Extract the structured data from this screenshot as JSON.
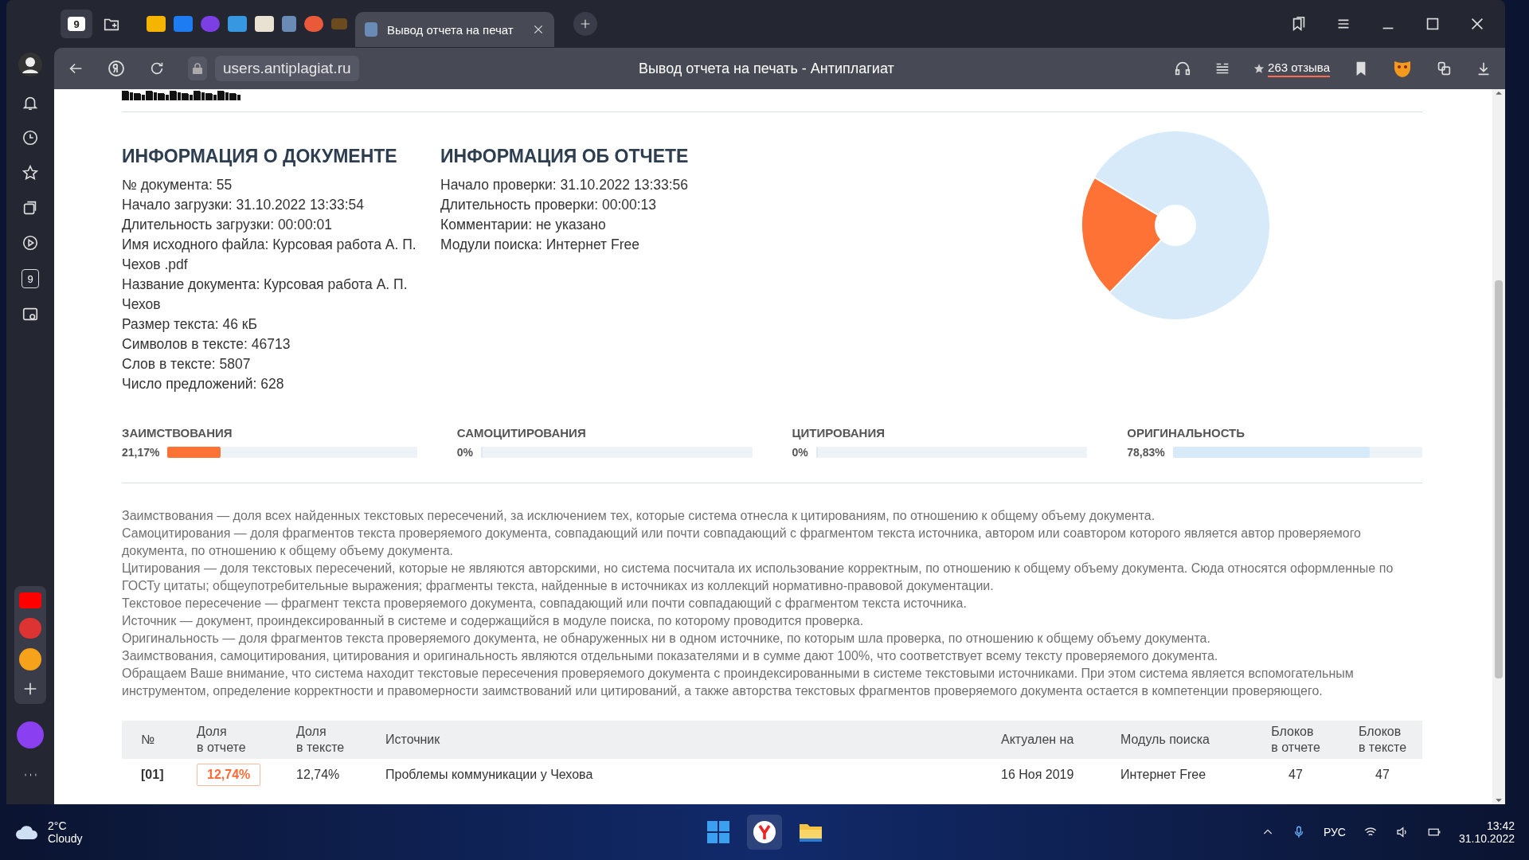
{
  "browser": {
    "home_badge": "9",
    "active_tab": {
      "title": "Вывод отчета на печат",
      "selected": true
    },
    "url": "users.antiplagiat.ru",
    "page_title": "Вывод отчета на печать - Антиплагиат",
    "reviews": "263 отзыва",
    "sidebar_badge": "9"
  },
  "document_info": {
    "title": "ИНФОРМАЦИЯ О ДОКУМЕНТЕ",
    "lines": [
      "№ документа: 55",
      "Начало загрузки: 31.10.2022 13:33:54",
      "Длительность загрузки: 00:00:01",
      "Имя исходного файла: Курсовая работа А. П. Чехов .pdf",
      "Название документа: Курсовая работа А. П. Чехов",
      "Размер текста: 46 кБ",
      "Символов в тексте: 46713",
      "Слов в тексте: 5807",
      "Число предложений: 628"
    ]
  },
  "report_info": {
    "title": "ИНФОРМАЦИЯ ОБ ОТЧЕТЕ",
    "lines": [
      "Начало проверки: 31.10.2022 13:33:56",
      "Длительность проверки: 00:00:13",
      "Комментарии: не указано",
      "Модули поиска: Интернет Free"
    ]
  },
  "stats": [
    {
      "label": "ЗАИМСТВОВАНИЯ",
      "value": "21,17%",
      "level": 0.2117,
      "color": "#ff7236"
    },
    {
      "label": "САМОЦИТИРОВАНИЯ",
      "value": "0%",
      "level": 0
    },
    {
      "label": "ЦИТИРОВАНИЯ",
      "value": "0%",
      "level": 0
    },
    {
      "label": "ОРИГИНАЛЬНОСТЬ",
      "value": "78,83%",
      "level": 0.7883,
      "color": "#d6eafa"
    }
  ],
  "notes": [
    "Заимствования — доля всех найденных текстовых пересечений, за исключением тех, которые система отнесла к цитированиям, по отношению к общему объему документа.",
    "Самоцитирования — доля фрагментов текста проверяемого документа, совпадающий или почти совпадающий с фрагментом текста источника, автором или соавтором которого является автор проверяемого документа, по отношению к общему объему документа.",
    "Цитирования — доля текстовых пересечений, которые не являются авторскими, но система посчитала их использование корректным, по отношению к общему объему документа. Сюда относятся оформленные по ГОСТу цитаты; общеупотребительные выражения; фрагменты текста, найденные в источниках из коллекций нормативно-правовой документации.",
    "Текстовое пересечение — фрагмент текста проверяемого документа, совпадающий или почти совпадающий с фрагментом текста источника.",
    "Источник — документ, проиндексированный в системе и содержащийся в модуле поиска, по которому проводится проверка.",
    "Оригинальность — доля фрагментов текста проверяемого документа, не обнаруженных ни в одном источнике, по которым шла проверка, по отношению к общему объему документа.",
    "Заимствования, самоцитирования, цитирования и оригинальность являются отдельными показателями и в сумме дают 100%, что соответствует всему тексту проверяемого документа.",
    "Обращаем Ваше внимание, что система находит текстовые пересечения проверяемого документа с проиндексированными в системе текстовыми источниками. При этом система является вспомогательным инструментом, определение корректности и правомерности заимствований или цитирований, а также авторства текстовых фрагментов проверяемого документа остается в компетенции проверяющего."
  ],
  "table": {
    "columns": [
      "№",
      "Доля в отчете",
      "Доля в тексте",
      "Источник",
      "Актуален на",
      "Модуль поиска",
      "Блоков в отчете",
      "Блоков в тексте"
    ],
    "rows": [
      {
        "cells": [
          "[01]",
          "12,74%",
          "12,74%",
          "Проблемы коммуникации у Чехова",
          "16 Ноя 2019",
          "Интернет Free",
          "47",
          "47"
        ]
      }
    ]
  },
  "taskbar": {
    "temperature": "2°C",
    "weather": "Cloudy",
    "language": "РУС",
    "time": "13:42",
    "date": "31.10.2022"
  }
}
